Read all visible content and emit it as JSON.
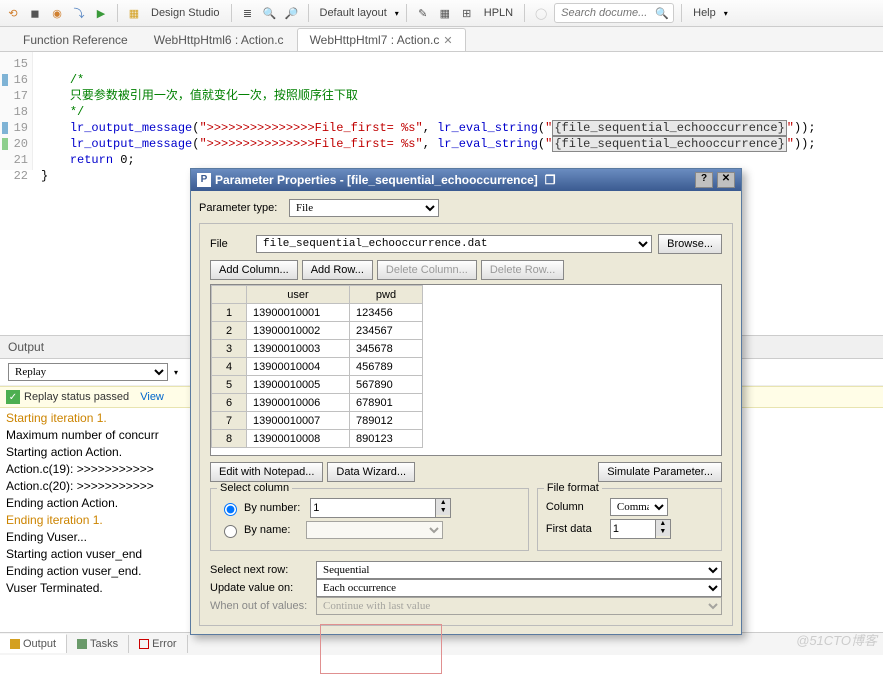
{
  "toolbar": {
    "design_studio": "Design Studio",
    "layout": "Default layout",
    "hpln": "HPLN",
    "search_placeholder": "Search docume...",
    "help": "Help"
  },
  "tabs": [
    {
      "label": "Function Reference",
      "active": false,
      "closable": false
    },
    {
      "label": "WebHttpHtml6 : Action.c",
      "active": false,
      "closable": false
    },
    {
      "label": "WebHttpHtml7 : Action.c",
      "active": true,
      "closable": true
    }
  ],
  "editor": {
    "lines": [
      15,
      16,
      17,
      18,
      19,
      20,
      21,
      22
    ],
    "comment1": "/*",
    "comment2": "只要参数被引用一次，值就变化一次，按照顺序往下取",
    "comment3": "*/",
    "func": "lr_output_message",
    "str": "\">>>>>>>>>>>>>>>File_first= %s\"",
    "eval": "lr_eval_string",
    "param": "{file_sequential_echooccurrence}",
    "ret": "return",
    "zero": "0"
  },
  "output": {
    "title": "Output",
    "replay_option": "Replay",
    "status": "Replay status passed",
    "view_link": "View",
    "log": [
      {
        "t": "Starting iteration 1.",
        "c": "iter"
      },
      {
        "t": "Maximum number of concurr",
        "c": ""
      },
      {
        "t": "Starting action Action.",
        "c": ""
      },
      {
        "t": "Action.c(19): >>>>>>>>>>>",
        "c": ""
      },
      {
        "t": "Action.c(20): >>>>>>>>>>>",
        "c": ""
      },
      {
        "t": "Ending action Action.",
        "c": ""
      },
      {
        "t": "Ending iteration 1.",
        "c": "iter"
      },
      {
        "t": "Ending Vuser...",
        "c": ""
      },
      {
        "t": "Starting action vuser_end",
        "c": ""
      },
      {
        "t": "Ending action vuser_end.",
        "c": ""
      },
      {
        "t": "Vuser Terminated.",
        "c": ""
      }
    ],
    "bottom_tabs": [
      "Output",
      "Tasks",
      "Error"
    ]
  },
  "dialog": {
    "title": "Parameter Properties - [file_sequential_echooccurrence]",
    "param_type_label": "Parameter type:",
    "param_type": "File",
    "file_label": "File",
    "file_value": "file_sequential_echooccurrence.dat",
    "browse": "Browse...",
    "add_col": "Add Column...",
    "add_row": "Add Row...",
    "del_col": "Delete Column...",
    "del_row": "Delete Row...",
    "headers": [
      "user",
      "pwd"
    ],
    "rows": [
      [
        "1",
        "13900010001",
        "123456"
      ],
      [
        "2",
        "13900010002",
        "234567"
      ],
      [
        "3",
        "13900010003",
        "345678"
      ],
      [
        "4",
        "13900010004",
        "456789"
      ],
      [
        "5",
        "13900010005",
        "567890"
      ],
      [
        "6",
        "13900010006",
        "678901"
      ],
      [
        "7",
        "13900010007",
        "789012"
      ],
      [
        "8",
        "13900010008",
        "890123"
      ]
    ],
    "edit_notepad": "Edit with Notepad...",
    "data_wizard": "Data Wizard...",
    "simulate": "Simulate Parameter...",
    "select_column": "Select column",
    "by_number": "By number:",
    "by_number_val": "1",
    "by_name": "By name:",
    "file_format": "File format",
    "column_label": "Column",
    "column_val": "Comma",
    "first_data_label": "First data",
    "first_data_val": "1",
    "select_next_row": "Select next row:",
    "select_next_row_val": "Sequential",
    "update_value_on": "Update value on:",
    "update_value_on_val": "Each occurrence",
    "when_out": "When out of values:",
    "when_out_val": "Continue with last value"
  },
  "watermark": "@51CTO博客"
}
